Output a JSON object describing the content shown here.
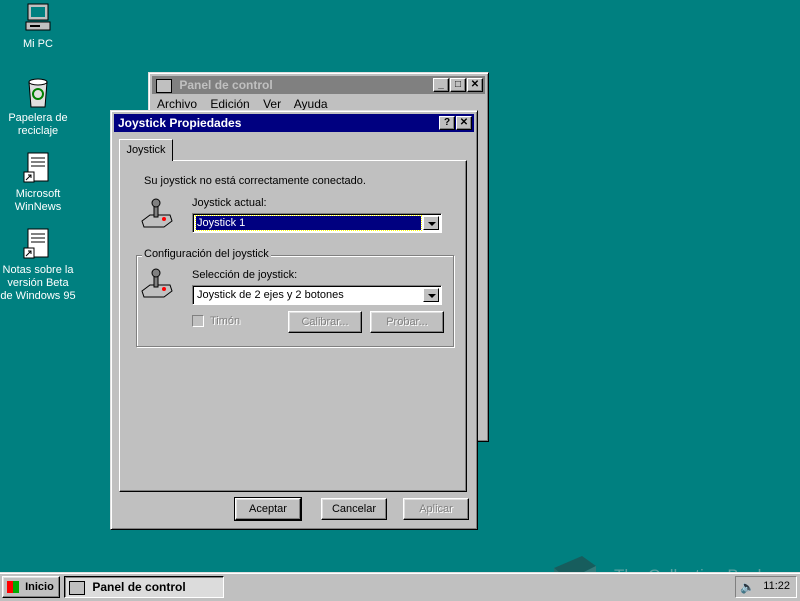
{
  "desktop": {
    "icons": [
      {
        "label": "Mi PC",
        "icon": "computer-icon"
      },
      {
        "label": "Papelera de reciclaje",
        "icon": "recycle-bin-icon"
      },
      {
        "label": "Microsoft WinNews",
        "icon": "document-shortcut-icon"
      },
      {
        "label": "Notas sobre la versión Beta de Windows 95",
        "icon": "document-shortcut-icon"
      }
    ]
  },
  "control_panel": {
    "title": "Panel de control",
    "menu": [
      "Archivo",
      "Edición",
      "Ver",
      "Ayuda"
    ]
  },
  "dialog": {
    "title": "Joystick Propiedades",
    "tab": "Joystick",
    "status_text": "Su joystick no está correctamente conectado.",
    "current_label": "Joystick actual:",
    "current_value": "Joystick 1",
    "group_label": "Configuración del joystick",
    "select_label": "Selección de joystick:",
    "select_value": "Joystick de 2 ejes y 2 botones",
    "rudder_label": "Timón",
    "calibrate_label": "Calibrar...",
    "test_label": "Probar...",
    "ok_label": "Aceptar",
    "cancel_label": "Cancelar",
    "apply_label": "Aplicar"
  },
  "taskbar": {
    "start_label": "Inicio",
    "task_label": "Panel de control",
    "clock": "11:22"
  },
  "watermark": "The Collection Book",
  "colors": {
    "desktop": "#008080",
    "active_title": "#000080",
    "face": "#c0c0c0"
  }
}
